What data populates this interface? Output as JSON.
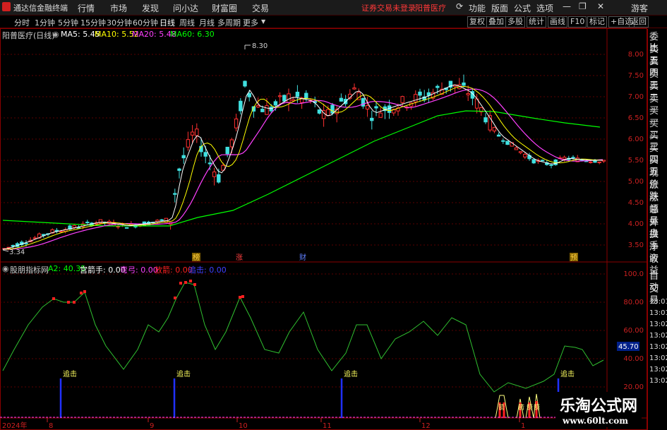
{
  "app": {
    "title": "通达信金融终端"
  },
  "menu": [
    "行情",
    "市场",
    "发现",
    "问小达",
    "财富圈",
    "交易"
  ],
  "notice": {
    "login_status": "证券交易未登录",
    "stock": "阳普医疗"
  },
  "topbar_buttons": [
    "功能",
    "版面",
    "公式",
    "选项",
    "游客"
  ],
  "periods": [
    "分时",
    "1分钟",
    "5分钟",
    "15分钟",
    "30分钟",
    "60分钟",
    "日线",
    "周线",
    "月线",
    "多周期",
    "更多"
  ],
  "active_period": "日线",
  "toolbar_right": [
    "复权",
    "叠加",
    "多股",
    "统计",
    "画线",
    "F10",
    "标记",
    "+自选",
    "返回"
  ],
  "main_chart": {
    "legend_title": "阳普医疗(日线)",
    "ma": [
      {
        "label": "MA5: 5.45",
        "color": "#ffffff"
      },
      {
        "label": "MA10: 5.52",
        "color": "#ffff00"
      },
      {
        "label": "MA20: 5.48",
        "color": "#ff40ff"
      },
      {
        "label": "MA60: 6.30",
        "color": "#00ff00"
      }
    ],
    "high_label": "8.30",
    "low_label": "3.34",
    "y_ticks": [
      "8.00",
      "7.50",
      "7.00",
      "6.50",
      "6.00",
      "5.50",
      "5.00",
      "4.50",
      "4.00",
      "3.50"
    ],
    "events": [
      "榜",
      "涨",
      "财",
      "预"
    ]
  },
  "sub_chart": {
    "name": "股朋指标网",
    "values": [
      {
        "label": "A2: 40.35",
        "color": "#00ff00"
      },
      {
        "label": "宫箭手: 0.00",
        "color": "#ffffff"
      },
      {
        "label": "弯弓: 0.00",
        "color": "#ff40ff"
      },
      {
        "label": "放箭: 0.00",
        "color": "#ff2020"
      },
      {
        "label": "追击: 0.00",
        "color": "#4040ff"
      }
    ],
    "y_ticks": [
      "100.0",
      "80.00",
      "60.00",
      "40.00",
      "20.00"
    ],
    "current_value": "45.70",
    "chase_label": "追击",
    "arrow_label": "箭"
  },
  "x_axis": [
    "2024年",
    "8",
    "9",
    "10",
    "11",
    "12",
    "1"
  ],
  "side_panel": [
    "委比",
    "卖五",
    "卖四",
    "卖三",
    "卖二",
    "卖一",
    "买一",
    "买二",
    "买三",
    "买四",
    "买五",
    "现价",
    "涨跌",
    "涨幅",
    "总量",
    "外盘",
    "换手",
    "净资",
    "收益"
  ],
  "side_panel_bottom": [
    "自动",
    "交易"
  ],
  "side_times": [
    "13:01",
    "13:01",
    "13:02",
    "13:02",
    "13:02",
    "13:02",
    "13:02",
    "13:02"
  ],
  "watermark": {
    "cn": "乐淘公式网",
    "url": "www.60lt.com"
  }
}
